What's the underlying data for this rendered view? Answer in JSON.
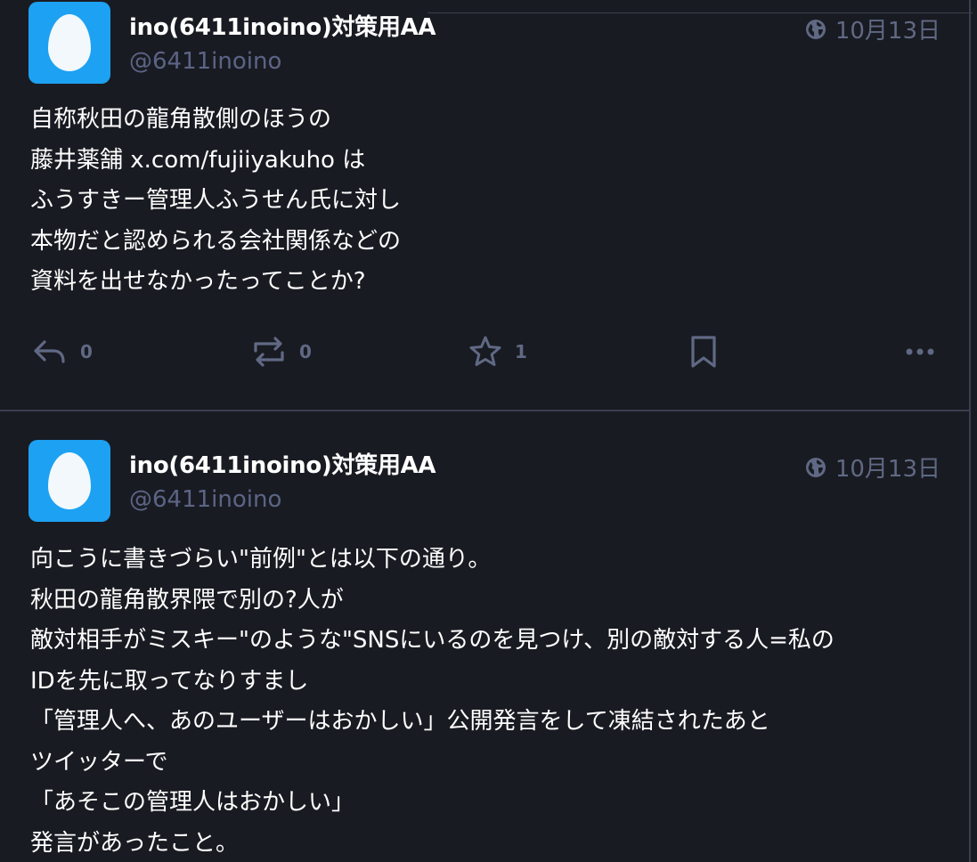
{
  "statuses": [
    {
      "display_name": "ino(6411inoino)対策用AA",
      "handle": "@6411inoino",
      "date": "10月13日",
      "visibility_icon": "globe-icon",
      "content_lines": [
        "自称秋田の龍角散側のほうの",
        "藤井薬舗 x.com/fujiiyakuho は",
        "ふうすきー管理人ふうせん氏に対し",
        "本物だと認められる会社関係などの",
        "資料を出せなかったってことか?"
      ],
      "actions": {
        "reply_count": "0",
        "boost_count": "0",
        "favourite_count": "1"
      }
    },
    {
      "display_name": "ino(6411inoino)対策用AA",
      "handle": "@6411inoino",
      "date": "10月13日",
      "visibility_icon": "globe-icon",
      "content_lines": [
        "向こうに書きづらい\"前例\"とは以下の通り。",
        "秋田の龍角散界隈で別の?人が",
        "敵対相手がミスキー\"のような\"SNSにいるのを見つけ、別の敵対する人=私の",
        "IDを先に取ってなりすまし",
        "「管理人へ、あのユーザーはおかしい」公開発言をして凍結されたあと",
        "ツイッターで",
        "「あそこの管理人はおかしい」",
        "発言があったこと。"
      ]
    }
  ],
  "colors": {
    "background": "#191b22",
    "divider": "#393f4f",
    "muted_text": "#606984",
    "avatar_bg": "#1da1f2"
  }
}
